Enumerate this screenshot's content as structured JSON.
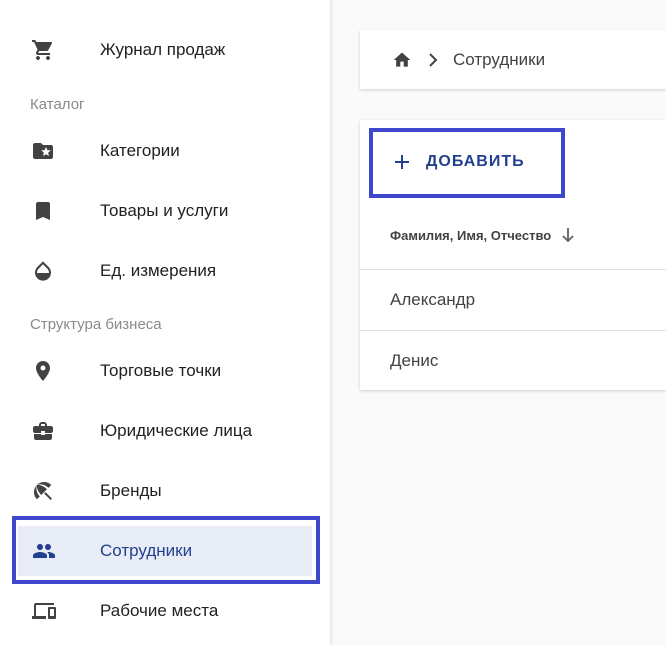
{
  "sidebar": {
    "items": [
      {
        "label": "Журнал продаж",
        "icon": "cart-icon"
      },
      {
        "label": "Категории",
        "icon": "folder-star-icon"
      },
      {
        "label": "Товары и услуги",
        "icon": "bookmark-icon"
      },
      {
        "label": "Ед. измерения",
        "icon": "drop-icon"
      },
      {
        "label": "Торговые точки",
        "icon": "location-pin-icon"
      },
      {
        "label": "Юридические лица",
        "icon": "briefcase-icon"
      },
      {
        "label": "Бренды",
        "icon": "beach-umbrella-icon"
      },
      {
        "label": "Сотрудники",
        "icon": "people-icon",
        "active": true
      },
      {
        "label": "Рабочие места",
        "icon": "devices-icon"
      }
    ],
    "sections": {
      "catalog": "Каталог",
      "business_structure": "Структура бизнеса"
    }
  },
  "breadcrumb": {
    "home_icon": "home-icon",
    "current": "Сотрудники"
  },
  "employees": {
    "add_label": "ДОБАВИТЬ",
    "column_header": "Фамилия, Имя, Отчество",
    "rows": [
      {
        "name": "Александр"
      },
      {
        "name": "Денис"
      }
    ]
  },
  "colors": {
    "accent": "#23408e",
    "active_bg": "#e8ecf6",
    "highlight": "#3f48cc",
    "icon": "#424242"
  }
}
